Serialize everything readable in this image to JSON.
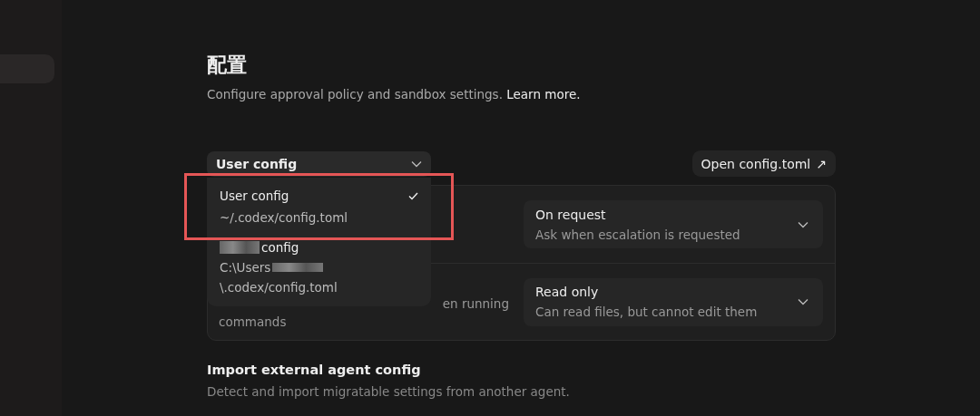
{
  "sidebar": {
    "items": [
      {
        "selected": true
      }
    ]
  },
  "title": "配置",
  "subtitle": {
    "text": "Configure approval policy and sandbox settings.",
    "link": "Learn more."
  },
  "config_select": {
    "value": "User config"
  },
  "open_button": {
    "label": "Open config.toml",
    "icon": "↗"
  },
  "settings": [
    {
      "select": {
        "value": "On request",
        "hint": "Ask when escalation is requested"
      }
    },
    {
      "description_visible": [
        "en running",
        "commands"
      ],
      "select": {
        "value": "Read only",
        "hint": "Can read files, but cannot edit them"
      }
    }
  ],
  "menu": {
    "items": [
      {
        "name": "User config",
        "path_lines": [
          "~/.codex/config.toml"
        ],
        "selected": true,
        "highlighted": true,
        "redacted": false
      },
      {
        "name": "config",
        "path_lines": [
          "C:\\Users",
          "\\.codex/config.toml"
        ],
        "selected": false,
        "highlighted": false,
        "redacted": true
      }
    ]
  },
  "import_section": {
    "heading": "Import external agent config",
    "description": "Detect and import migratable settings from another agent."
  }
}
